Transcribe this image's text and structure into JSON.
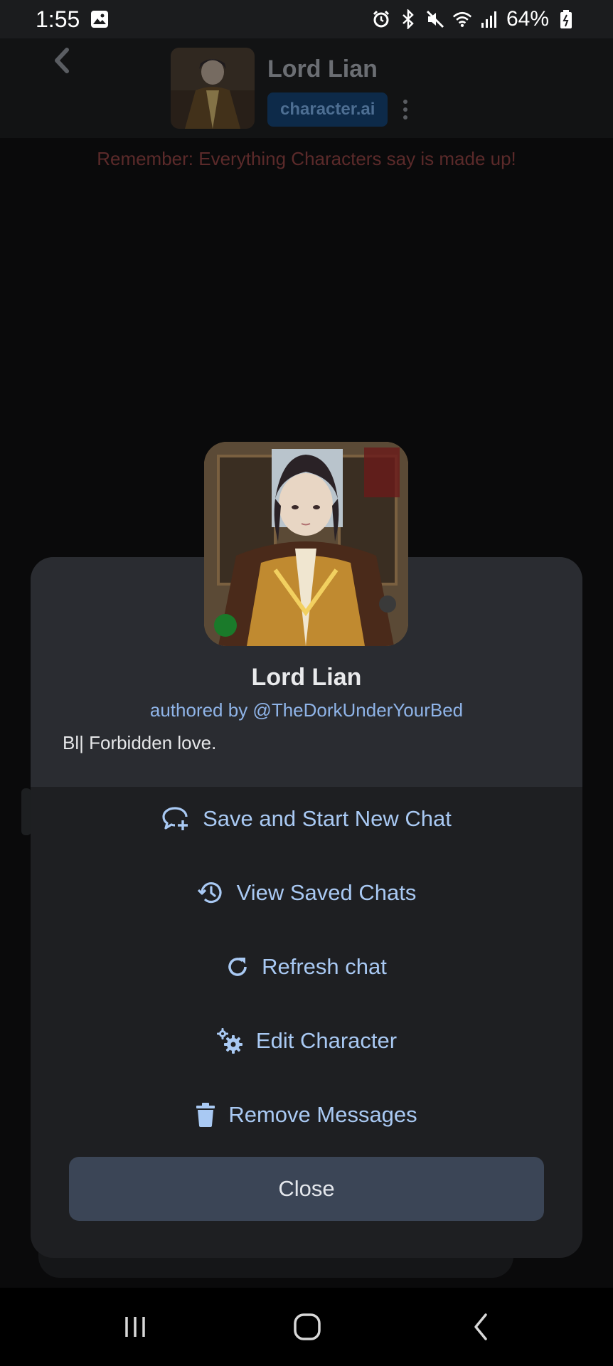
{
  "status_bar": {
    "time": "1:55",
    "battery": "64%",
    "icons": [
      "gallery-icon",
      "alarm-icon",
      "bluetooth-icon",
      "mute-icon",
      "wifi-icon",
      "signal-icon",
      "battery-icon"
    ]
  },
  "header": {
    "character_name": "Lord Lian",
    "brand_badge": "character.ai",
    "disclaimer": "Remember: Everything Characters say is made up!"
  },
  "modal": {
    "character_name": "Lord Lian",
    "author": "authored by @TheDorkUnderYourBed",
    "description": "Bl| Forbidden love.",
    "menu": [
      {
        "label": "Save and Start New Chat",
        "icon": "chat-plus-icon"
      },
      {
        "label": "View Saved Chats",
        "icon": "history-icon"
      },
      {
        "label": "Refresh chat",
        "icon": "refresh-icon"
      },
      {
        "label": "Edit Character",
        "icon": "gears-icon"
      },
      {
        "label": "Remove Messages",
        "icon": "trash-icon"
      }
    ],
    "close_label": "Close"
  },
  "colors": {
    "accent": "#a9c9f3",
    "modal_bg": "#1e1f22",
    "modal_top_bg": "#2a2c31",
    "close_button": "#3b4556"
  }
}
